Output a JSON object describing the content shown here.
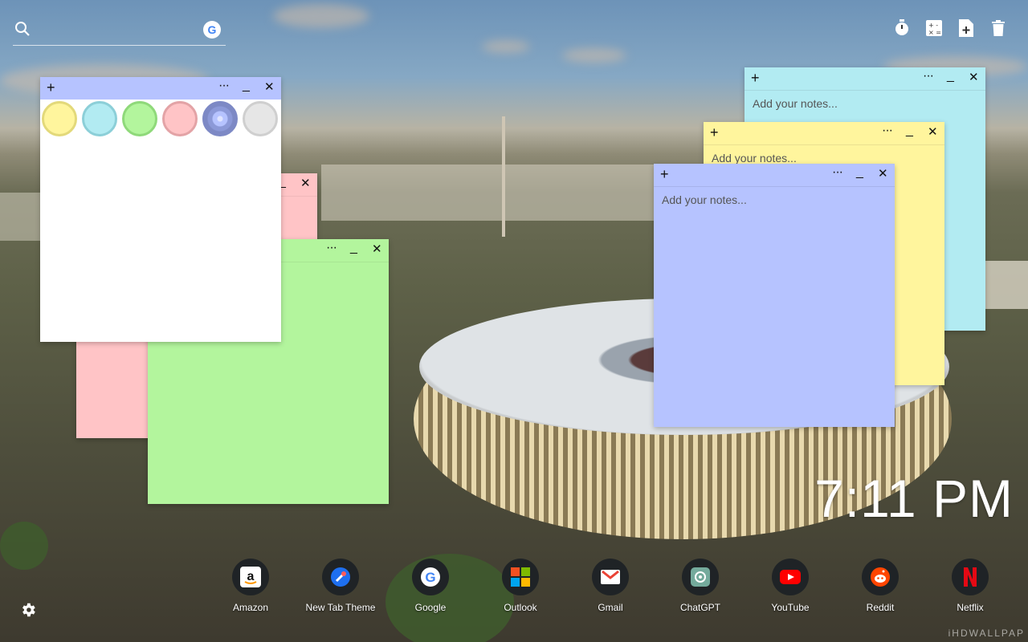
{
  "search": {
    "icon": "search-icon",
    "engine_icon": "google-icon",
    "engine_glyph": "G"
  },
  "toolbar": {
    "icons": [
      "timer-icon",
      "calculator-icon",
      "add-note-icon",
      "trash-icon"
    ]
  },
  "notes": {
    "placeholder": "Add your notes...",
    "controls": {
      "add": "+",
      "more": "···",
      "minimize": "_",
      "close": "✕"
    },
    "colors": {
      "yellow": "#fff59d",
      "cyan": "#b2ebf2",
      "green": "#b3f59d",
      "pink": "#ffc4c6",
      "blue": "#b6c3ff",
      "white": "#ffffff",
      "gray": "#e6e6e6"
    },
    "color_picker": [
      "yellow",
      "cyan",
      "green",
      "pink",
      "blue",
      "gray"
    ],
    "active_color": "blue"
  },
  "clock": {
    "time": "7:11 PM"
  },
  "shortcuts": [
    {
      "label": "Amazon",
      "icon": "amazon-icon"
    },
    {
      "label": "New Tab Theme",
      "icon": "new-tab-theme-icon"
    },
    {
      "label": "Google",
      "icon": "google-icon"
    },
    {
      "label": "Outlook",
      "icon": "outlook-icon"
    },
    {
      "label": "Gmail",
      "icon": "gmail-icon"
    },
    {
      "label": "ChatGPT",
      "icon": "chatgpt-icon"
    },
    {
      "label": "YouTube",
      "icon": "youtube-icon"
    },
    {
      "label": "Reddit",
      "icon": "reddit-icon"
    },
    {
      "label": "Netflix",
      "icon": "netflix-icon"
    }
  ],
  "settings": {
    "icon": "gear-icon"
  },
  "watermark": "iHDWALLPAP"
}
